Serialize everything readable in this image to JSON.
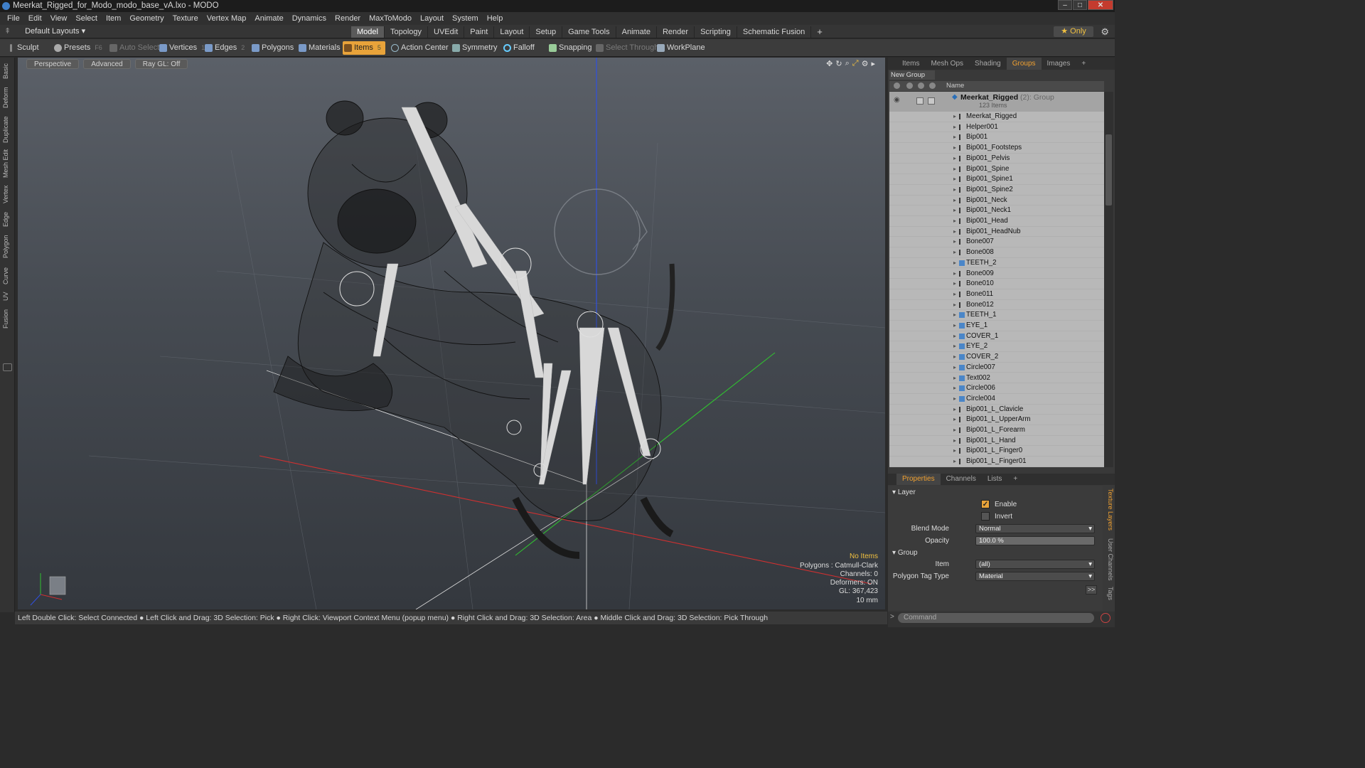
{
  "window": {
    "title": "Meerkat_Rigged_for_Modo_modo_base_vA.lxo - MODO"
  },
  "menu": [
    "File",
    "Edit",
    "View",
    "Select",
    "Item",
    "Geometry",
    "Texture",
    "Vertex Map",
    "Animate",
    "Dynamics",
    "Render",
    "MaxToModo",
    "Layout",
    "System",
    "Help"
  ],
  "layout_selector": "Default Layouts",
  "layout_tabs": [
    "Model",
    "Topology",
    "UVEdit",
    "Paint",
    "Layout",
    "Setup",
    "Game Tools",
    "Animate",
    "Render",
    "Scripting",
    "Schematic Fusion"
  ],
  "only_label": "Only",
  "toolbar": {
    "sculpt": "Sculpt",
    "presets": "Presets",
    "presets_key": "F6",
    "auto_select": "Auto Select",
    "vertices": "Vertices",
    "vertices_key": "1",
    "edges": "Edges",
    "edges_key": "2",
    "polygons": "Polygons",
    "materials": "Materials",
    "items": "Items",
    "items_key": "5",
    "action_center": "Action Center",
    "symmetry": "Symmetry",
    "falloff": "Falloff",
    "snapping": "Snapping",
    "select_through": "Select Through",
    "workplane": "WorkPlane"
  },
  "left_tabs": [
    "Basic",
    "Deform",
    "Duplicate",
    "Mesh Edit",
    "Vertex",
    "Edge",
    "Polygon",
    "Curve",
    "UV",
    "Fusion"
  ],
  "viewport": {
    "buttons": [
      "Perspective",
      "Advanced",
      "Ray GL: Off"
    ],
    "info": {
      "items": "No Items",
      "polygons": "Polygons : Catmull-Clark",
      "channels": "Channels: 0",
      "deformers": "Deformers: ON",
      "gl": "GL: 367,423",
      "unit": "10 mm"
    }
  },
  "status_bar": "Left Double Click: Select Connected ● Left Click and Drag: 3D Selection: Pick ● Right Click: Viewport Context Menu (popup menu) ● Right Click and Drag: 3D Selection: Area ● Middle Click and Drag: 3D Selection: Pick Through",
  "panel_tabs": [
    "Items",
    "Mesh Ops",
    "Shading",
    "Groups",
    "Images"
  ],
  "new_group": "New Group",
  "list_header": "Name",
  "group": {
    "name": "Meerkat_Rigged",
    "count": "(2)",
    "type": ": Group",
    "sub": "123 Items"
  },
  "items": [
    "Meerkat_Rigged",
    "Helper001",
    "Bip001",
    "Bip001_Footsteps",
    "Bip001_Pelvis",
    "Bip001_Spine",
    "Bip001_Spine1",
    "Bip001_Spine2",
    "Bip001_Neck",
    "Bip001_Neck1",
    "Bip001_Head",
    "Bip001_HeadNub",
    "Bone007",
    "Bone008",
    "TEETH_2",
    "Bone009",
    "Bone010",
    "Bone011",
    "Bone012",
    "TEETH_1",
    "EYE_1",
    "COVER_1",
    "EYE_2",
    "COVER_2",
    "Circle007",
    "Text002",
    "Circle006",
    "Circle004",
    "Bip001_L_Clavicle",
    "Bip001_L_UpperArm",
    "Bip001_L_Forearm",
    "Bip001_L_Hand",
    "Bip001_L_Finger0",
    "Bip001_L_Finger01"
  ],
  "prop_tabs": [
    "Properties",
    "Channels",
    "Lists"
  ],
  "properties": {
    "layer_section": "Layer",
    "enable": "Enable",
    "invert": "Invert",
    "blend_mode_label": "Blend Mode",
    "blend_mode": "Normal",
    "opacity_label": "Opacity",
    "opacity": "100.0 %",
    "group_section": "Group",
    "item_label": "Item",
    "item_value": "(all)",
    "ptag_label": "Polygon Tag Type",
    "ptag_value": "Material"
  },
  "right_vtabs": [
    "Texture Layers",
    "User Channels",
    "Tags"
  ],
  "command_placeholder": "Command",
  "colors": {
    "accent": "#e8a33a",
    "x_axis": "#d03030",
    "y_axis": "#30c030",
    "z_axis": "#3050e0"
  }
}
